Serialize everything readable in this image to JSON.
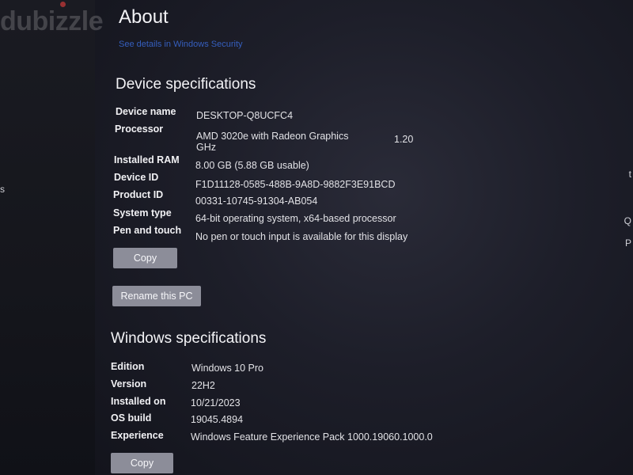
{
  "watermark": "dubizzle",
  "page": {
    "title": "About",
    "security_link": "See details in Windows Security"
  },
  "device_specs": {
    "heading": "Device specifications",
    "rows": [
      {
        "label": "Device name",
        "value": "DESKTOP-Q8UCFC4"
      },
      {
        "label": "Processor",
        "value": "AMD 3020e with Radeon Graphics",
        "value_line2": "GHz",
        "value_extra": "1.20"
      },
      {
        "label": "Installed RAM",
        "value": "8.00 GB (5.88 GB usable)"
      },
      {
        "label": "Device ID",
        "value": "F1D11128-0585-488B-9A8D-9882F3E91BCD"
      },
      {
        "label": "Product ID",
        "value": "00331-10745-91304-AB054"
      },
      {
        "label": "System type",
        "value": "64-bit operating system, x64-based processor"
      },
      {
        "label": "Pen and touch",
        "value": "No pen or touch input is available for this display"
      }
    ],
    "copy_label": "Copy",
    "rename_label": "Rename this PC"
  },
  "windows_specs": {
    "heading": "Windows specifications",
    "rows": [
      {
        "label": "Edition",
        "value": "Windows 10 Pro"
      },
      {
        "label": "Version",
        "value": "22H2"
      },
      {
        "label": "Installed on",
        "value": "10/21/2023"
      },
      {
        "label": "OS build",
        "value": "19045.4894"
      },
      {
        "label": "Experience",
        "value": "Windows Feature Experience Pack 1000.19060.1000.0"
      }
    ],
    "copy_label": "Copy"
  },
  "edge_glyphs": {
    "left": "s",
    "right_top": "t",
    "right_mid": "Q",
    "right_low": "P"
  },
  "colors": {
    "background": "#1d1e29",
    "button": "#8c8d99",
    "link": "#3a6ad8"
  }
}
